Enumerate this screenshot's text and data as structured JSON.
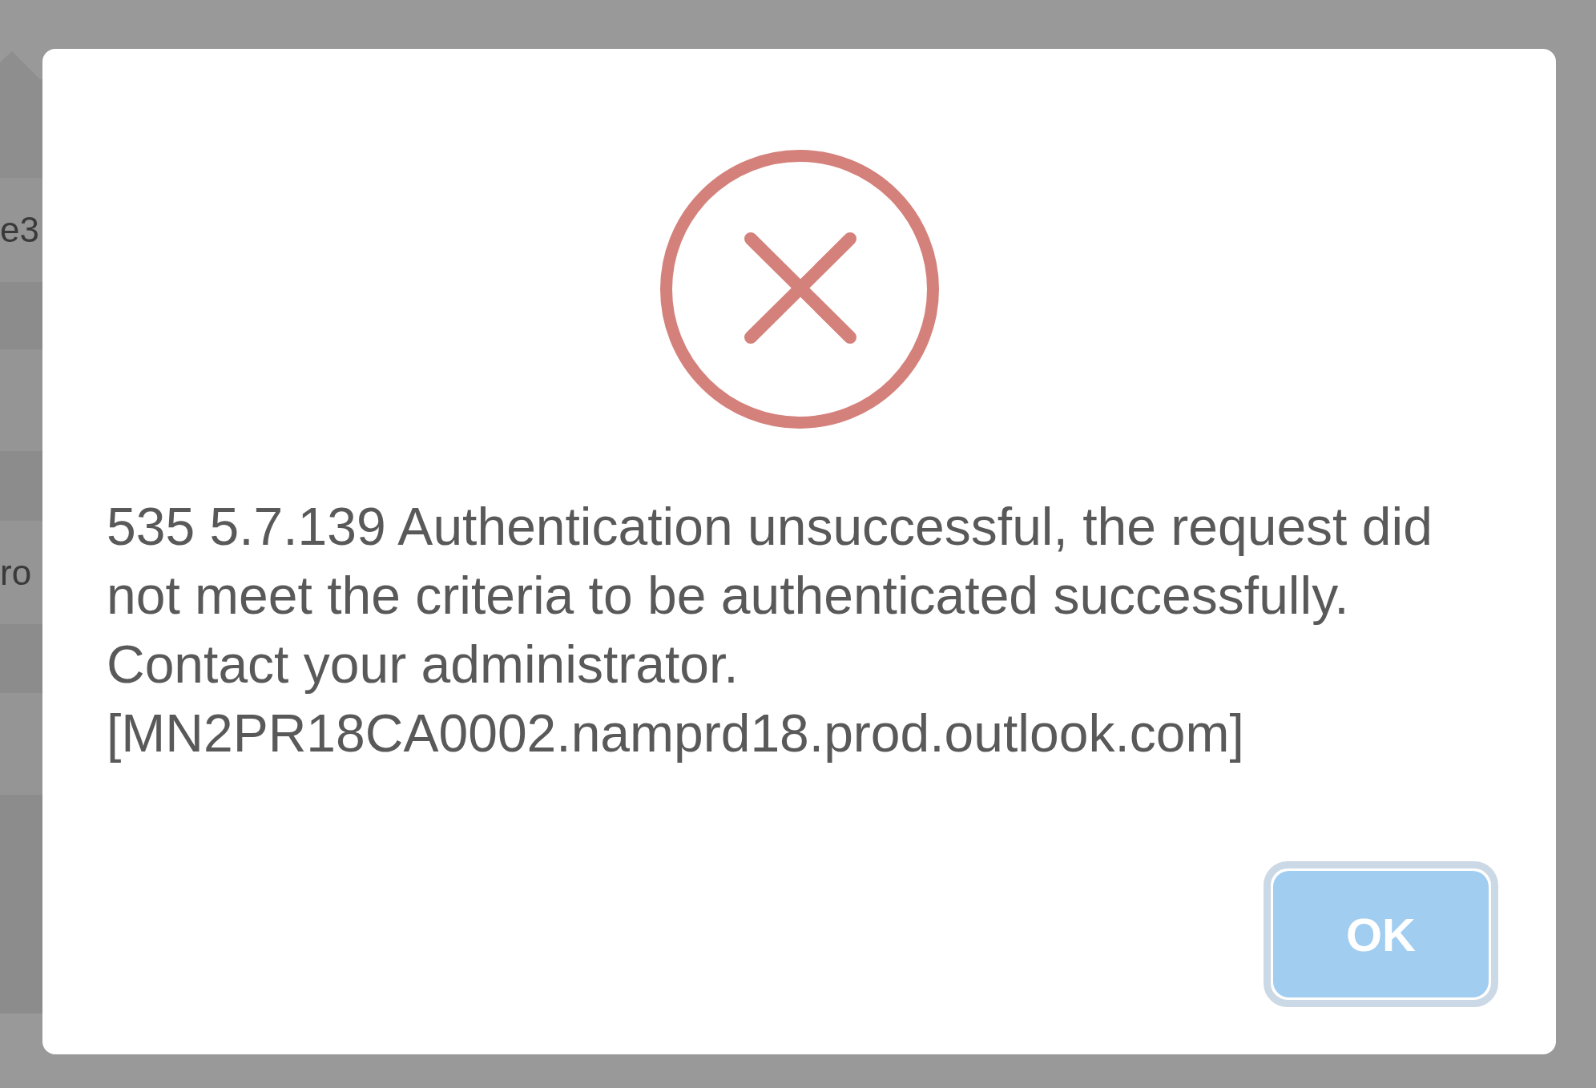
{
  "background_table": {
    "cells": [
      "e3",
      "ro"
    ]
  },
  "dialog": {
    "message": "535 5.7.139 Authentication unsuccessful, the request did not meet the criteria to be authenticated successfully. Contact your administrator. [MN2PR18CA0002.namprd18.prod.outlook.com]",
    "button": {
      "label": "OK",
      "focused": true
    }
  }
}
